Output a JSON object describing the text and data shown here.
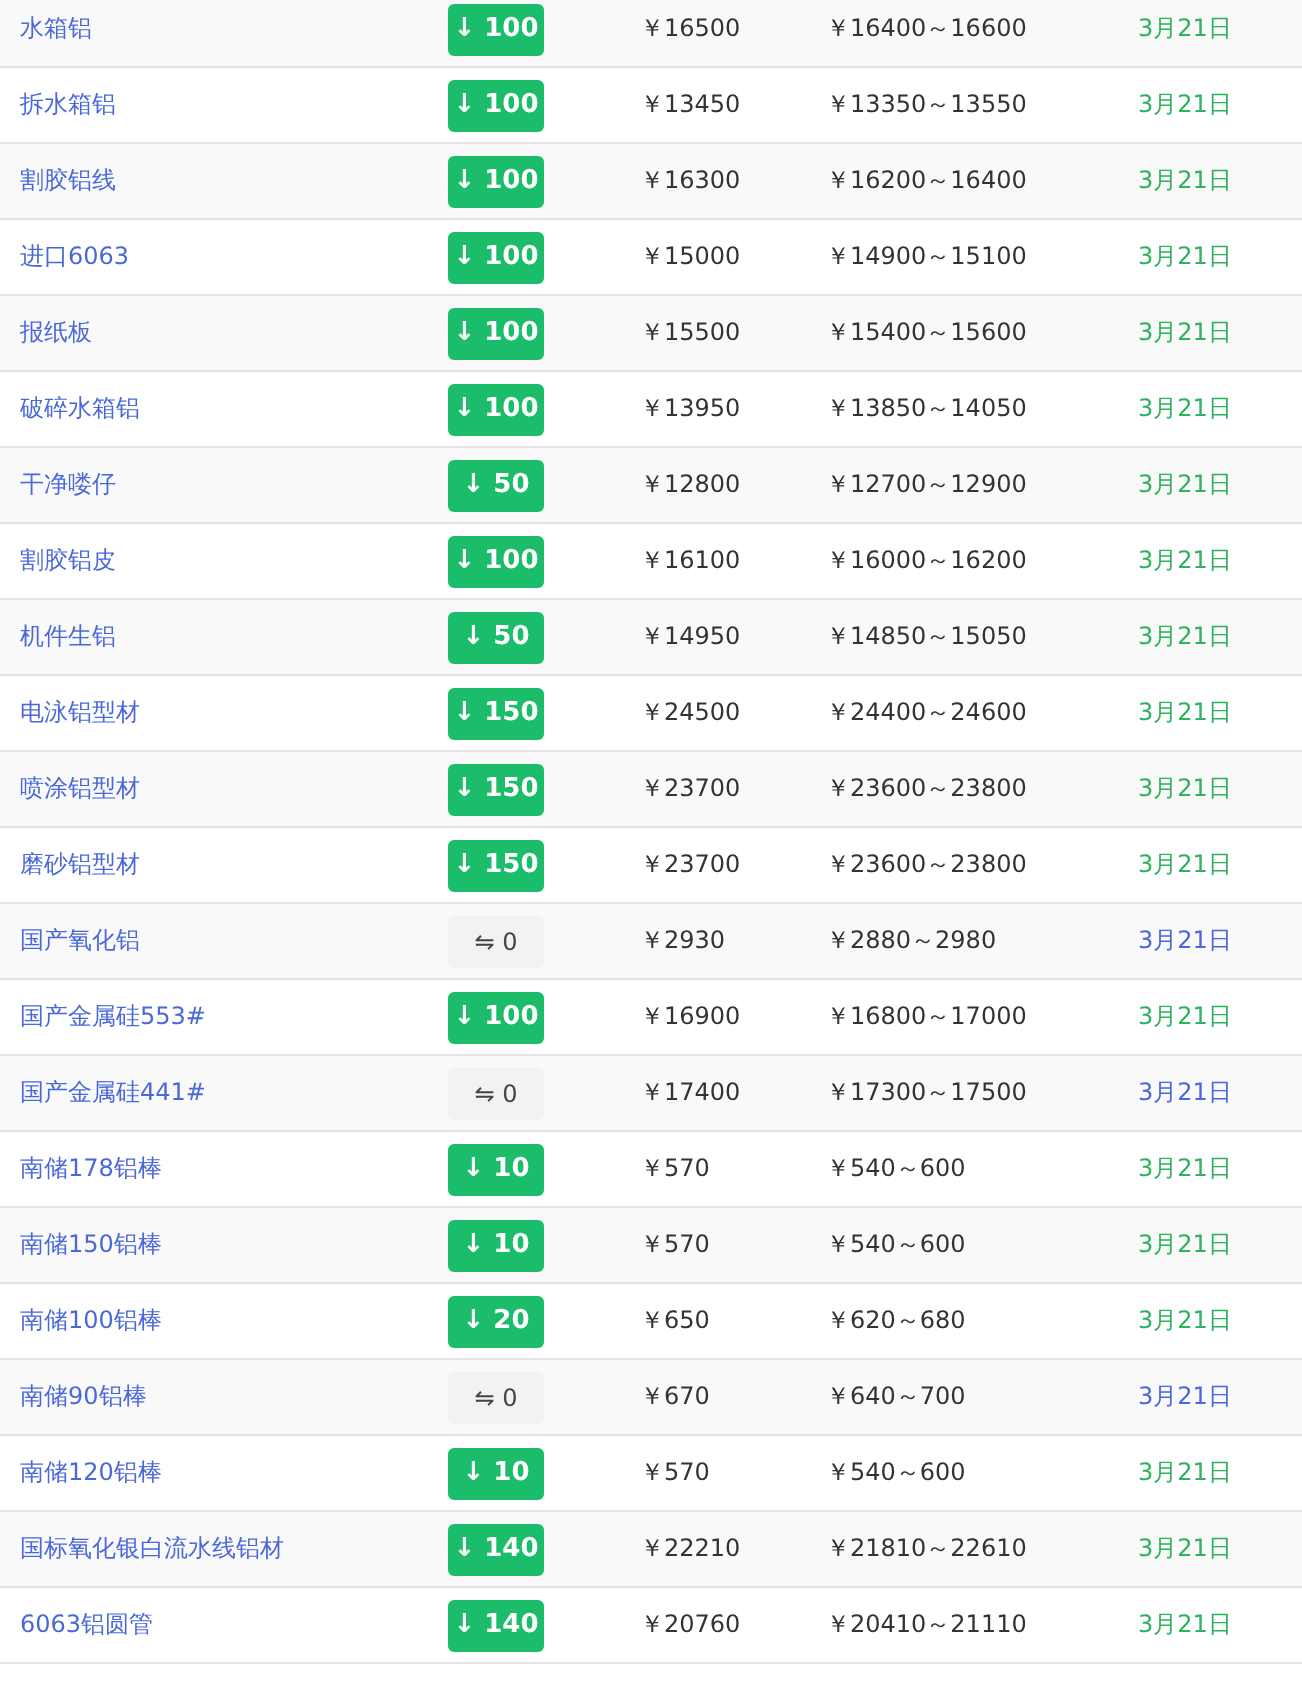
{
  "rows": [
    {
      "name": "水箱铝",
      "kind": "down",
      "change": "↓ 100",
      "price": "￥16500",
      "range": "￥16400～16600",
      "date": "3月21日"
    },
    {
      "name": "拆水箱铝",
      "kind": "down",
      "change": "↓ 100",
      "price": "￥13450",
      "range": "￥13350～13550",
      "date": "3月21日"
    },
    {
      "name": "割胶铝线",
      "kind": "down",
      "change": "↓ 100",
      "price": "￥16300",
      "range": "￥16200～16400",
      "date": "3月21日"
    },
    {
      "name": "进口6063",
      "kind": "down",
      "change": "↓ 100",
      "price": "￥15000",
      "range": "￥14900～15100",
      "date": "3月21日"
    },
    {
      "name": "报纸板",
      "kind": "down",
      "change": "↓ 100",
      "price": "￥15500",
      "range": "￥15400～15600",
      "date": "3月21日"
    },
    {
      "name": "破碎水箱铝",
      "kind": "down",
      "change": "↓ 100",
      "price": "￥13950",
      "range": "￥13850～14050",
      "date": "3月21日"
    },
    {
      "name": "干净喽仔",
      "kind": "down",
      "change": "↓ 50",
      "price": "￥12800",
      "range": "￥12700～12900",
      "date": "3月21日"
    },
    {
      "name": "割胶铝皮",
      "kind": "down",
      "change": "↓ 100",
      "price": "￥16100",
      "range": "￥16000～16200",
      "date": "3月21日"
    },
    {
      "name": "机件生铝",
      "kind": "down",
      "change": "↓ 50",
      "price": "￥14950",
      "range": "￥14850～15050",
      "date": "3月21日"
    },
    {
      "name": "电泳铝型材",
      "kind": "down",
      "change": "↓ 150",
      "price": "￥24500",
      "range": "￥24400～24600",
      "date": "3月21日"
    },
    {
      "name": "喷涂铝型材",
      "kind": "down",
      "change": "↓ 150",
      "price": "￥23700",
      "range": "￥23600～23800",
      "date": "3月21日"
    },
    {
      "name": "磨砂铝型材",
      "kind": "down",
      "change": "↓ 150",
      "price": "￥23700",
      "range": "￥23600～23800",
      "date": "3月21日"
    },
    {
      "name": "国产氧化铝",
      "kind": "flat",
      "change": "⇋ 0",
      "price": "￥2930",
      "range": "￥2880～2980",
      "date": "3月21日"
    },
    {
      "name": "国产金属硅553#",
      "kind": "down",
      "change": "↓ 100",
      "price": "￥16900",
      "range": "￥16800～17000",
      "date": "3月21日"
    },
    {
      "name": "国产金属硅441#",
      "kind": "flat",
      "change": "⇋ 0",
      "price": "￥17400",
      "range": "￥17300～17500",
      "date": "3月21日"
    },
    {
      "name": "南储178铝棒",
      "kind": "down",
      "change": "↓ 10",
      "price": "￥570",
      "range": "￥540～600",
      "date": "3月21日"
    },
    {
      "name": "南储150铝棒",
      "kind": "down",
      "change": "↓ 10",
      "price": "￥570",
      "range": "￥540～600",
      "date": "3月21日"
    },
    {
      "name": "南储100铝棒",
      "kind": "down",
      "change": "↓ 20",
      "price": "￥650",
      "range": "￥620～680",
      "date": "3月21日"
    },
    {
      "name": "南储90铝棒",
      "kind": "flat",
      "change": "⇋ 0",
      "price": "￥670",
      "range": "￥640～700",
      "date": "3月21日"
    },
    {
      "name": "南储120铝棒",
      "kind": "down",
      "change": "↓ 10",
      "price": "￥570",
      "range": "￥540～600",
      "date": "3月21日"
    },
    {
      "name": "国标氧化银白流水线铝材",
      "kind": "down",
      "change": "↓ 140",
      "price": "￥22210",
      "range": "￥21810～22610",
      "date": "3月21日"
    },
    {
      "name": "6063铝圆管",
      "kind": "down",
      "change": "↓ 140",
      "price": "￥20760",
      "range": "￥20410～21110",
      "date": "3月21日"
    }
  ]
}
